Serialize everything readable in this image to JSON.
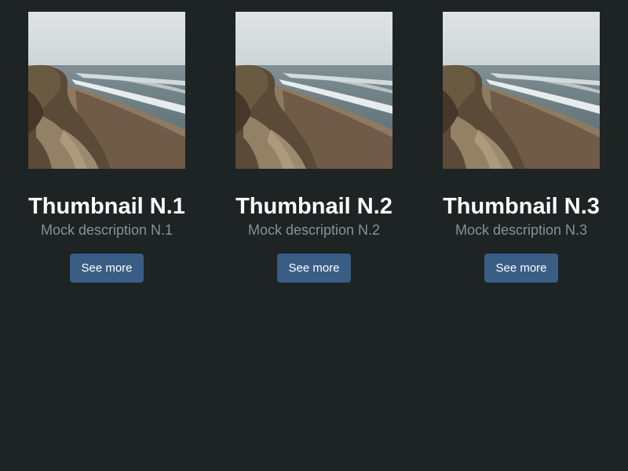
{
  "cards": [
    {
      "title": "Thumbnail N.1",
      "description": "Mock description N.1",
      "button_label": "See more"
    },
    {
      "title": "Thumbnail N.2",
      "description": "Mock description N.2",
      "button_label": "See more"
    },
    {
      "title": "Thumbnail N.3",
      "description": "Mock description N.3",
      "button_label": "See more"
    }
  ],
  "colors": {
    "background": "#1e2324",
    "button": "#3a5d86",
    "title": "#ffffff",
    "description": "#8a9193"
  }
}
